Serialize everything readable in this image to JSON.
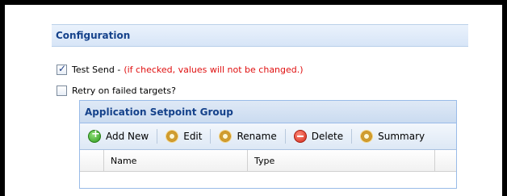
{
  "configuration": {
    "title": "Configuration"
  },
  "options": {
    "test_send": {
      "label": "Test Send -",
      "note": "(if checked, values will not be changed.)",
      "checked": true
    },
    "retry": {
      "label": "Retry on failed targets?",
      "checked": false
    }
  },
  "panel": {
    "title": "Application Setpoint Group",
    "toolbar": [
      {
        "label": "Add New",
        "icon": "add-icon"
      },
      {
        "label": "Edit",
        "icon": "edit-gear-icon"
      },
      {
        "label": "Rename",
        "icon": "rename-gear-icon"
      },
      {
        "label": "Delete",
        "icon": "delete-icon"
      },
      {
        "label": "Summary",
        "icon": "summary-gear-icon"
      }
    ],
    "columns": [
      "Name",
      "Type"
    ]
  },
  "colors": {
    "header_text": "#15428b",
    "note_text": "#e01010",
    "panel_border": "#99bbe8"
  }
}
